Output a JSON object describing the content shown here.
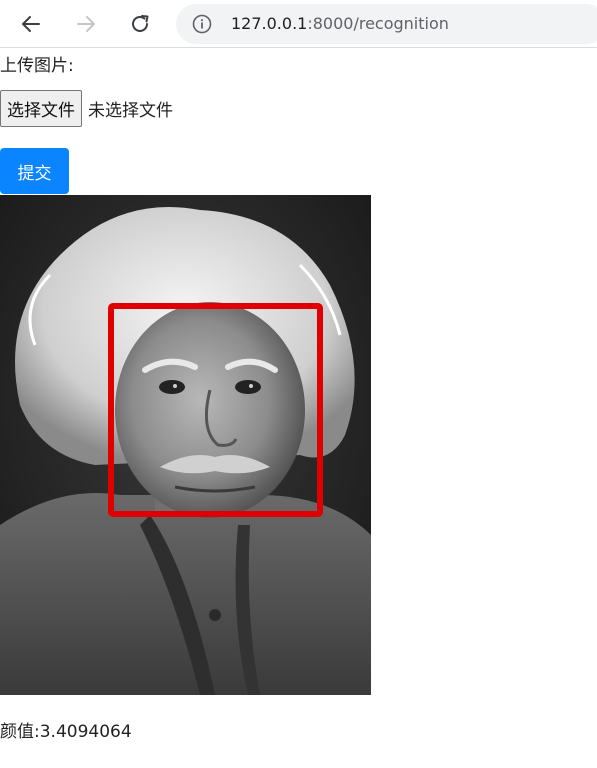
{
  "browser": {
    "url_host": "127.0.0.1",
    "url_rest": ":8000/recognition",
    "icons": [
      "back-arrow-icon",
      "forward-arrow-icon",
      "reload-icon",
      "info-icon"
    ]
  },
  "form": {
    "upload_label": "上传图片:",
    "file_button_label": "选择文件",
    "file_status": "未选择文件",
    "submit_label": "提交",
    "accent_color": "#0a84ff"
  },
  "result": {
    "face_box_color": "#e00000",
    "score_label": "颜值:",
    "score_value": "3.4094064"
  }
}
